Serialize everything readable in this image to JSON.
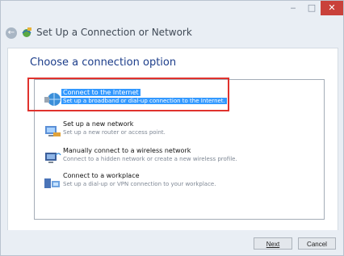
{
  "window": {
    "title": "Set Up a Connection or Network",
    "minimize_glyph": "‒",
    "maximize_glyph": "□",
    "close_glyph": "✕",
    "back_glyph": "←"
  },
  "main": {
    "heading": "Choose a connection option",
    "options": [
      {
        "title": "Connect to the Internet",
        "description": "Set up a broadband or dial-up connection to the Internet.",
        "icon": "globe-network-icon",
        "selected": true
      },
      {
        "title": "Set up a new network",
        "description": "Set up a new router or access point.",
        "icon": "router-computer-icon",
        "selected": false
      },
      {
        "title": "Manually connect to a wireless network",
        "description": "Connect to a hidden network or create a new wireless profile.",
        "icon": "wireless-computer-icon",
        "selected": false
      },
      {
        "title": "Connect to a workplace",
        "description": "Set up a dial-up or VPN connection to your workplace.",
        "icon": "workplace-vpn-icon",
        "selected": false
      }
    ]
  },
  "footer": {
    "next_label": "Next",
    "cancel_label": "Cancel"
  },
  "colors": {
    "selection": "#3399ff",
    "highlight_border": "#e0322d",
    "heading": "#1c3d8a",
    "close_button": "#c9413b"
  }
}
